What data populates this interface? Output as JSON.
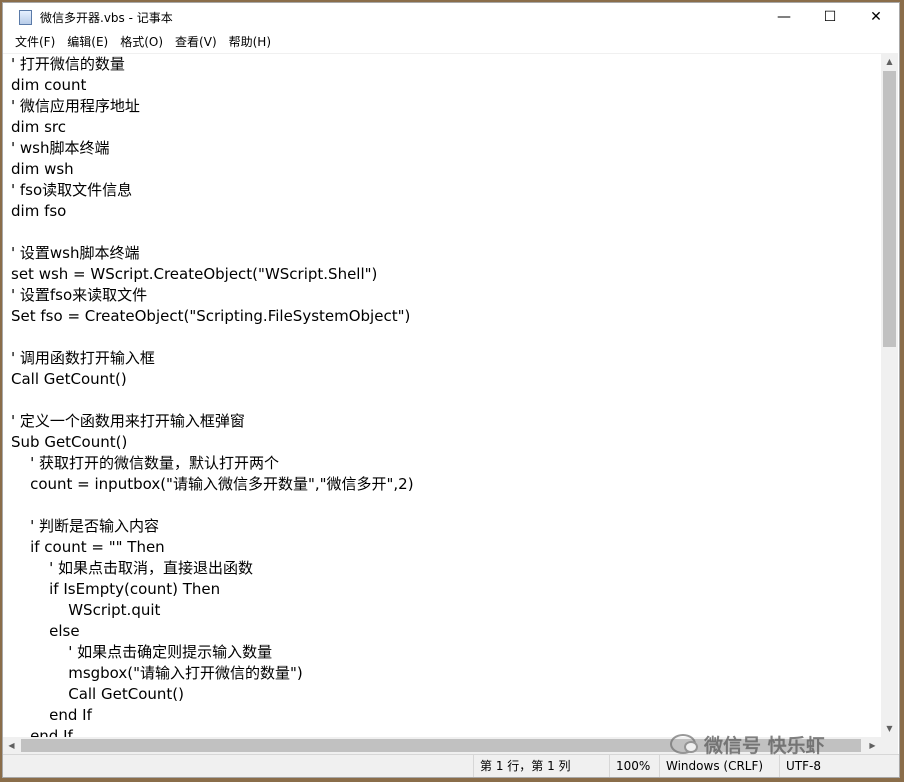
{
  "window": {
    "title": "微信多开器.vbs - 记事本",
    "minimize_glyph": "—",
    "maximize_glyph": "☐",
    "close_glyph": "✕"
  },
  "menu": [
    {
      "label": "文件(F)"
    },
    {
      "label": "编辑(E)"
    },
    {
      "label": "格式(O)"
    },
    {
      "label": "查看(V)"
    },
    {
      "label": "帮助(H)"
    }
  ],
  "editor": {
    "lines": [
      "' 打开微信的数量",
      "dim count",
      "' 微信应用程序地址",
      "dim src",
      "' wsh脚本终端",
      "dim wsh",
      "' fso读取文件信息",
      "dim fso",
      "",
      "' 设置wsh脚本终端",
      "set wsh = WScript.CreateObject(\"WScript.Shell\")",
      "' 设置fso来读取文件",
      "Set fso = CreateObject(\"Scripting.FileSystemObject\")",
      "",
      "' 调用函数打开输入框",
      "Call GetCount()",
      "",
      "' 定义一个函数用来打开输入框弹窗",
      "Sub GetCount()",
      "    ' 获取打开的微信数量，默认打开两个",
      "    count = inputbox(\"请输入微信多开数量\",\"微信多开\",2)",
      "",
      "    ' 判断是否输入内容",
      "    if count = \"\" Then",
      "        ' 如果点击取消，直接退出函数",
      "        if IsEmpty(count) Then",
      "            WScript.quit",
      "        else",
      "            ' 如果点击确定则提示输入数量",
      "            msgbox(\"请输入打开微信的数量\")",
      "            Call GetCount()",
      "        end If",
      "    end If"
    ]
  },
  "scrollbars": {
    "up_glyph": "▲",
    "down_glyph": "▼",
    "left_glyph": "◀",
    "right_glyph": "▶"
  },
  "status": {
    "position": "第 1 行，第 1 列",
    "zoom": "100%",
    "line_ending": "Windows (CRLF)",
    "encoding": "UTF-8"
  },
  "watermark": {
    "text": "微信号 快乐虾"
  }
}
